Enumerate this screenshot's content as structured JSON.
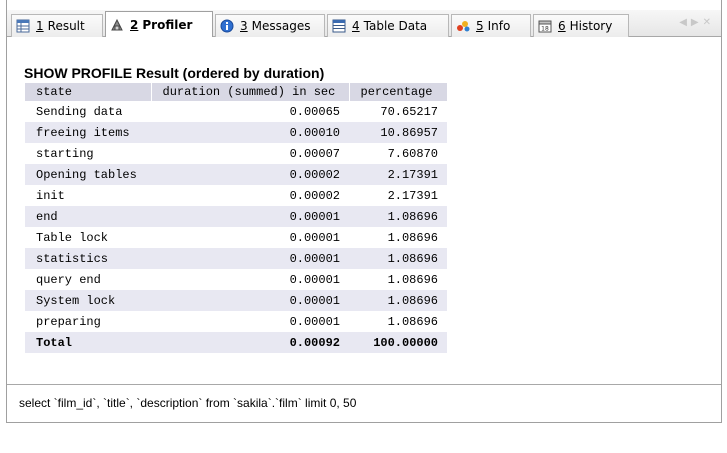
{
  "tabs": [
    {
      "num": "1",
      "label": "Result",
      "icon": "result-icon"
    },
    {
      "num": "2",
      "label": "Profiler",
      "icon": "profiler-icon",
      "active": true
    },
    {
      "num": "3",
      "label": "Messages",
      "icon": "messages-icon"
    },
    {
      "num": "4",
      "label": "Table Data",
      "icon": "table-data-icon"
    },
    {
      "num": "5",
      "label": "Info",
      "icon": "info-icon"
    },
    {
      "num": "6",
      "label": "History",
      "icon": "history-icon"
    }
  ],
  "history_icon_text": "18",
  "tab_scroll": {
    "left": "◀",
    "right": "▶",
    "close": "✕"
  },
  "profile": {
    "title": "SHOW PROFILE Result (ordered by duration)",
    "columns": [
      "state",
      "duration (summed) in sec",
      "percentage"
    ],
    "rows": [
      [
        "Sending data",
        "0.00065",
        "70.65217"
      ],
      [
        "freeing items",
        "0.00010",
        "10.86957"
      ],
      [
        "starting",
        "0.00007",
        "7.60870"
      ],
      [
        "Opening tables",
        "0.00002",
        "2.17391"
      ],
      [
        "init",
        "0.00002",
        "2.17391"
      ],
      [
        "end",
        "0.00001",
        "1.08696"
      ],
      [
        "Table lock",
        "0.00001",
        "1.08696"
      ],
      [
        "statistics",
        "0.00001",
        "1.08696"
      ],
      [
        "query end",
        "0.00001",
        "1.08696"
      ],
      [
        "System lock",
        "0.00001",
        "1.08696"
      ],
      [
        "preparing",
        "0.00001",
        "1.08696"
      ]
    ],
    "total": [
      "Total",
      "0.00092",
      "100.00000"
    ]
  },
  "query_text": "select  `film_id`, `title`, `description` from `sakila`.`film` limit 0, 50"
}
